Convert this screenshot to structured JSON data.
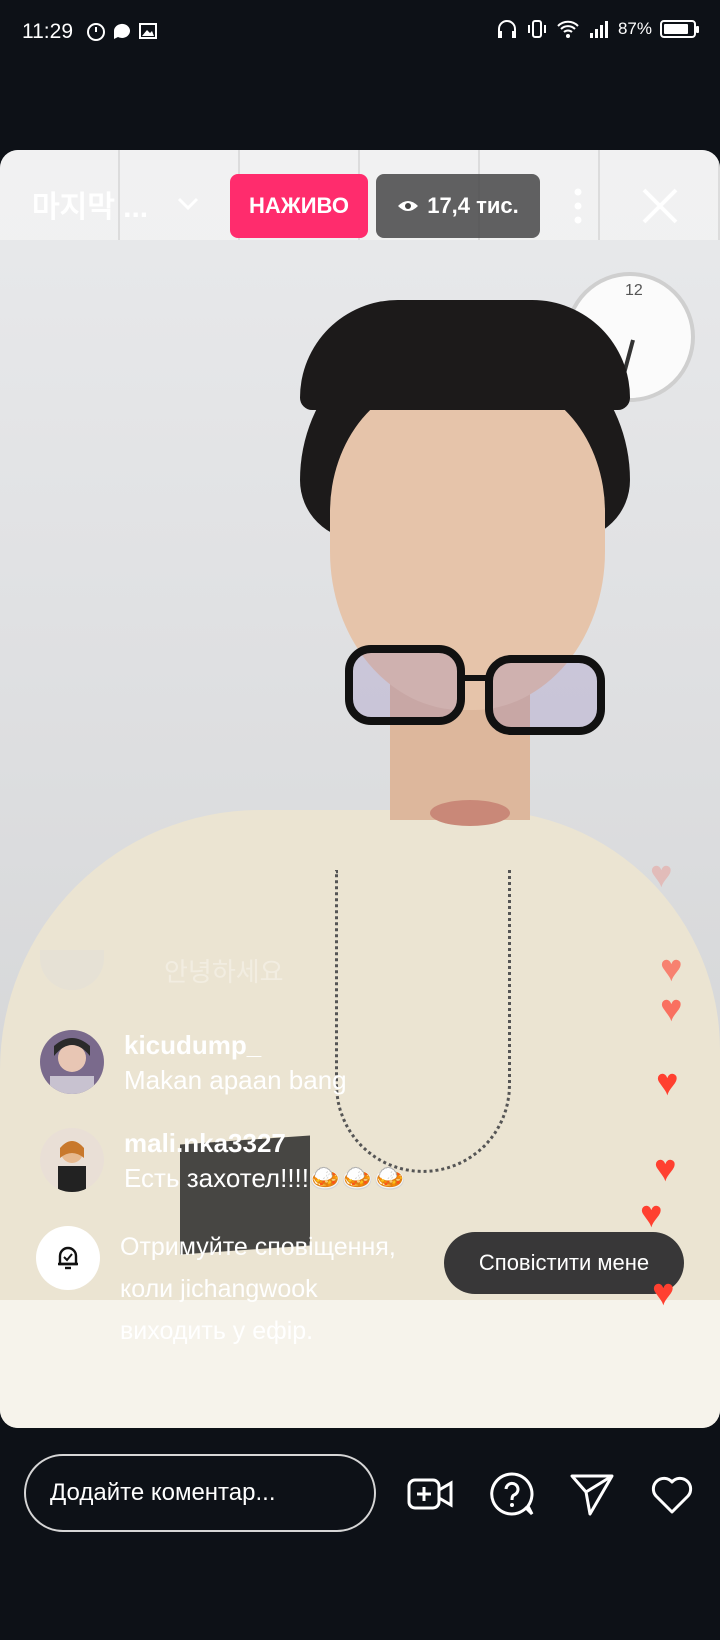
{
  "status_bar": {
    "time": "11:29",
    "battery_text": "87%",
    "battery_level": 0.87
  },
  "stream": {
    "title": "마지막 ...",
    "live_label": "НАЖИВО",
    "viewers": "17,4 тис."
  },
  "comments": {
    "faded_text": "안녕하세요",
    "items": [
      {
        "user": "kicudump_",
        "message": "Makan apaan bang"
      },
      {
        "user": "mali.nka3327",
        "message": "Есть захотел!!!!🍛🍛🍛"
      }
    ]
  },
  "notify": {
    "text": "Отримуйте сповіщення, коли jichangwook виходить у ефір.",
    "button": "Сповістити мене"
  },
  "bottom_bar": {
    "comment_placeholder": "Додайте коментар..."
  },
  "icons": [
    "timer-icon",
    "chat-icon",
    "gallery-icon",
    "headphones-icon",
    "vibrate-icon",
    "wifi-icon",
    "signal-icon",
    "battery-icon",
    "chevron-down-icon",
    "eye-icon",
    "more-icon",
    "close-icon",
    "bell-icon",
    "add-video-icon",
    "question-icon",
    "send-icon",
    "heart-icon"
  ],
  "colors": {
    "live": "#ff2c6d",
    "background": "#0d1117",
    "hearts": "#ff4030"
  }
}
